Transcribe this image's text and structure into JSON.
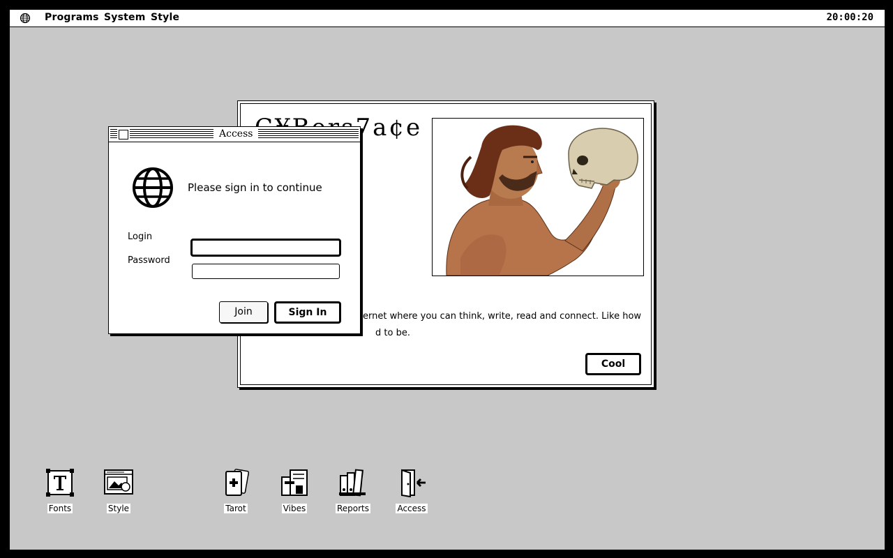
{
  "menubar": {
    "logo_icon": "globe-icon",
    "items": [
      "Programs",
      "System",
      "Style"
    ],
    "clock": "20:00:20"
  },
  "cyber_window": {
    "title": "C¥Bers7a¢e",
    "text_line1": "ernet where you can think, write, read and connect. Like how",
    "text_line2": "d to be.",
    "button": "Cool"
  },
  "access_window": {
    "title": "Access",
    "prompt": "Please sign in to continue",
    "login_label": "Login",
    "login_value": "",
    "password_label": "Password",
    "password_value": "",
    "join_button": "Join",
    "signin_button": "Sign In"
  },
  "desktop_icons": [
    {
      "label": "Fonts",
      "icon": "fonts-icon"
    },
    {
      "label": "Style",
      "icon": "style-icon"
    },
    {
      "label": "Tarot",
      "icon": "tarot-icon"
    },
    {
      "label": "Vibes",
      "icon": "vibes-icon"
    },
    {
      "label": "Reports",
      "icon": "reports-icon"
    },
    {
      "label": "Access",
      "icon": "access-icon"
    }
  ]
}
